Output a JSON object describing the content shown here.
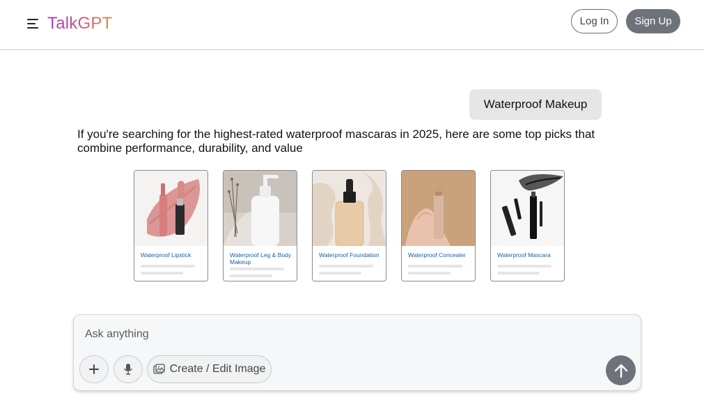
{
  "header": {
    "logo": "TalkGPT",
    "login_label": "Log In",
    "signup_label": "Sign Up"
  },
  "chat": {
    "user_message": "Waterproof Makeup",
    "answer": "If you're searching for the highest-rated waterproof mascaras in 2025, here are some top picks that combine performance, durability, and value"
  },
  "products": [
    {
      "title": "Waterproof Lipstick",
      "image": "lipstick-image"
    },
    {
      "title": "Waterproof Leg & Body Makeup",
      "image": "body-makeup-bottle-image"
    },
    {
      "title": "Waterproof Foundation",
      "image": "foundation-bottle-image"
    },
    {
      "title": "Waterproof Concealer",
      "image": "concealer-in-hand-image"
    },
    {
      "title": "Waterproof Mascara",
      "image": "mascara-image"
    }
  ],
  "composer": {
    "placeholder": "Ask anything",
    "create_image_label": "Create / Edit Image",
    "plus_icon": "plus-icon",
    "mic_icon": "microphone-icon",
    "send_icon": "arrow-up-icon"
  },
  "colors": {
    "signup_bg": "#6e737b",
    "send_bg": "#6e737b",
    "link_blue": "#1a5fa8",
    "bubble_bg": "#e6e6e6"
  }
}
